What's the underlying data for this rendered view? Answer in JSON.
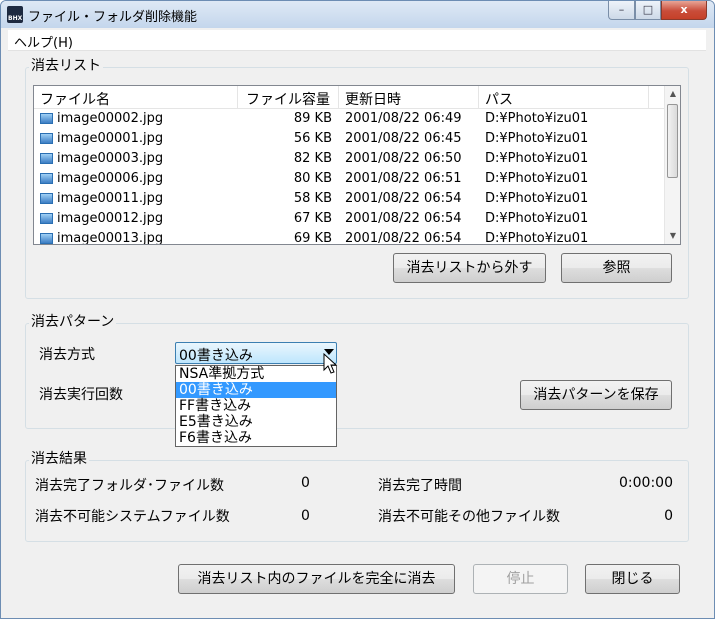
{
  "window": {
    "title": "ファイル・フォルダ削除機能",
    "icon_label": "BHX",
    "controls": {
      "minimize": "–",
      "maximize": "□",
      "close": "x"
    }
  },
  "menu": {
    "help": "ヘルプ(H)"
  },
  "erase_list": {
    "group_title": "消去リスト",
    "columns": [
      "ファイル名",
      "ファイル容量",
      "更新日時",
      "パス"
    ],
    "rows": [
      {
        "name": "image00002.jpg",
        "size": "89 KB",
        "date": "2001/08/22 06:49",
        "path": "D:¥Photo¥izu01"
      },
      {
        "name": "image00001.jpg",
        "size": "56 KB",
        "date": "2001/08/22 06:45",
        "path": "D:¥Photo¥izu01"
      },
      {
        "name": "image00003.jpg",
        "size": "82 KB",
        "date": "2001/08/22 06:50",
        "path": "D:¥Photo¥izu01"
      },
      {
        "name": "image00006.jpg",
        "size": "80 KB",
        "date": "2001/08/22 06:51",
        "path": "D:¥Photo¥izu01"
      },
      {
        "name": "image00011.jpg",
        "size": "58 KB",
        "date": "2001/08/22 06:54",
        "path": "D:¥Photo¥izu01"
      },
      {
        "name": "image00012.jpg",
        "size": "67 KB",
        "date": "2001/08/22 06:54",
        "path": "D:¥Photo¥izu01"
      },
      {
        "name": "image00013.jpg",
        "size": "69 KB",
        "date": "2001/08/22 06:54",
        "path": "D:¥Photo¥izu01"
      }
    ],
    "remove_button": "消去リストから外す",
    "browse_button": "参照"
  },
  "erase_pattern": {
    "group_title": "消去パターン",
    "method_label": "消去方式",
    "method_value": "00書き込み",
    "count_label": "消去実行回数",
    "options": [
      "NSA準拠方式",
      "00書き込み",
      "FF書き込み",
      "E5書き込み",
      "F6書き込み"
    ],
    "selected_index": 1,
    "save_button": "消去パターンを保存"
  },
  "erase_result": {
    "group_title": "消去結果",
    "completed_count_label": "消去完了フォルダ･ファイル数",
    "completed_count_value": "0",
    "completed_time_label": "消去完了時間",
    "completed_time_value": "0:00:00",
    "system_files_label": "消去不可能システムファイル数",
    "system_files_value": "0",
    "other_files_label": "消去不可能その他ファイル数",
    "other_files_value": "0"
  },
  "footer": {
    "erase_button": "消去リスト内のファイルを完全に消去",
    "stop_button": "停止",
    "close_button": "閉じる"
  }
}
